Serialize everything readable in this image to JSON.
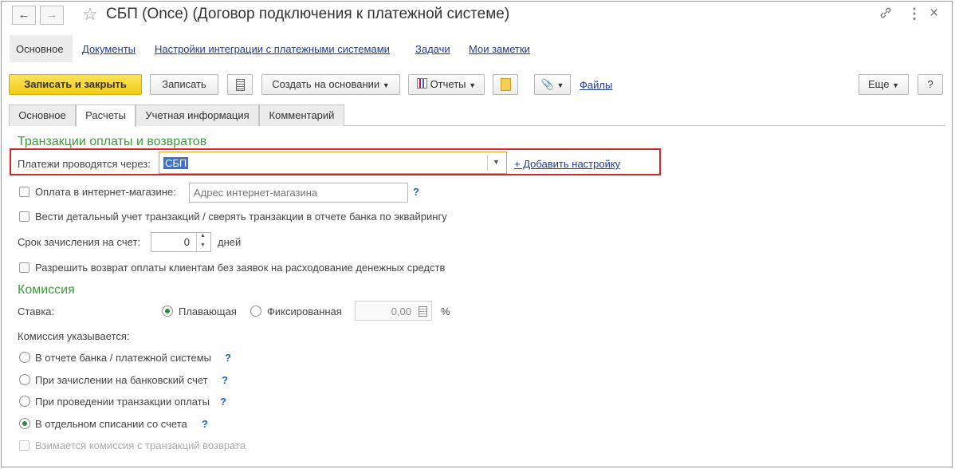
{
  "window": {
    "title": "СБП (Once) (Договор подключения к платежной системе)",
    "back_icon": "←",
    "forward_icon": "→",
    "star_icon": "☆",
    "link_icon": "🔗",
    "more_icon": "⋮",
    "close_icon": "×"
  },
  "nav": {
    "items": [
      {
        "label": "Основное"
      },
      {
        "label": "Документы"
      },
      {
        "label": "Настройки интеграции с платежными системами"
      },
      {
        "label": "Задачи"
      },
      {
        "label": "Мои заметки"
      }
    ]
  },
  "toolbar": {
    "save_close": "Записать и закрыть",
    "save": "Записать",
    "create_based": "Создать на основании",
    "reports": "Отчеты",
    "files": "Файлы",
    "more": "Еще",
    "help": "?"
  },
  "tabs": [
    {
      "label": "Основное"
    },
    {
      "label": "Расчеты"
    },
    {
      "label": "Учетная информация"
    },
    {
      "label": "Комментарий"
    }
  ],
  "transactions": {
    "heading": "Транзакции оплаты и возвратов",
    "payments_via_label": "Платежи проводятся через:",
    "payments_via_value": "СБП",
    "add_setting": "+ Добавить настройку",
    "online_store_label": "Оплата в интернет-магазине:",
    "online_store_placeholder": "Адрес интернет-магазина",
    "online_store_help": "?",
    "detailed_label": "Вести детальный учет транзакций / сверять транзакции в отчете банка по эквайрингу",
    "term_label": "Срок зачисления на счет:",
    "term_value": "0",
    "term_unit": "дней",
    "refund_label": "Разрешить возврат оплаты клиентам без заявок на расходование денежных средств"
  },
  "commission": {
    "heading": "Комиссия",
    "rate_label": "Ставка:",
    "floating": "Плавающая",
    "fixed": "Фиксированная",
    "fixed_value": "0,00",
    "percent": "%",
    "indicated_label": "Комиссия указывается:",
    "options": [
      {
        "label": "В отчете банка / платежной системы",
        "help": "?",
        "selected": false
      },
      {
        "label": "При зачислении на банковский счет",
        "help": "?",
        "selected": false
      },
      {
        "label": "При проведении транзакции оплаты",
        "help": "?",
        "selected": false
      },
      {
        "label": "В отдельном списании со счета",
        "help": "?",
        "selected": true
      }
    ],
    "refund_commission": "Взимается комиссия с транзакций возврата"
  },
  "colors": {
    "accent_yellow": "#f7d52a",
    "section_green": "#3a9c3a",
    "link_blue": "#1a3b9e",
    "highlight_red": "#d6242a"
  }
}
